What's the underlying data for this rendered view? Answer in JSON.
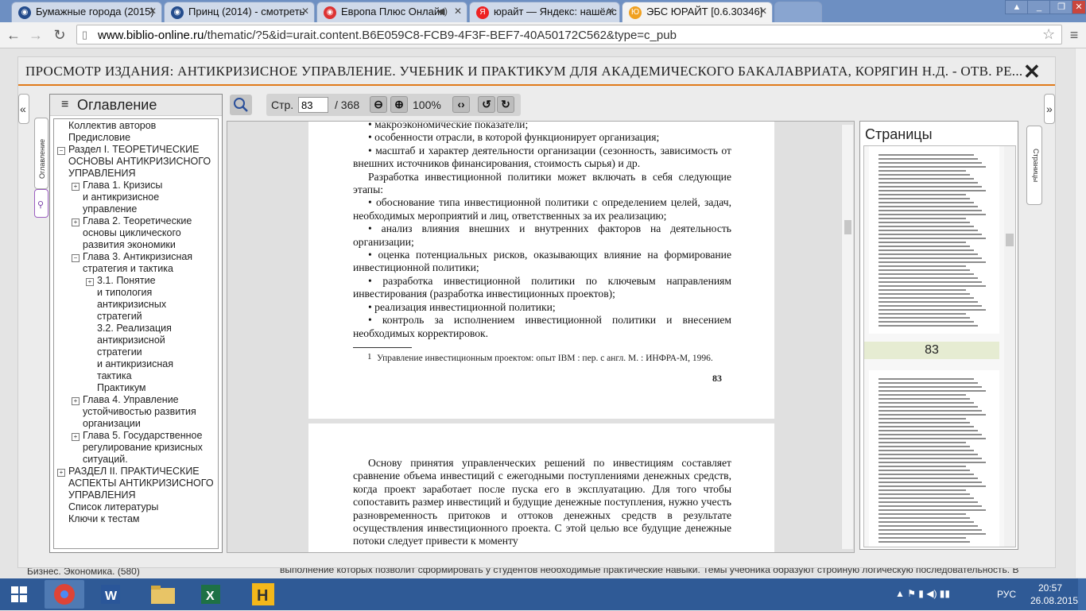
{
  "browser": {
    "tabs": [
      {
        "title": "Бумажные города (2015)",
        "active": false
      },
      {
        "title": "Принц (2014) - смотреть",
        "active": false
      },
      {
        "title": "Европа Плюс Онлайн",
        "active": false
      },
      {
        "title": "юрайт — Яндекс: нашёлс",
        "active": false
      },
      {
        "title": "ЭБС ЮРАЙТ [0.6.30346]",
        "active": true
      }
    ],
    "url_host": "www.biblio-online.ru",
    "url_path": "/thematic/?5&id=urait.content.B6E059C8-FCB9-4F3F-BEF7-40A50172C562&type=c_pub"
  },
  "viewer": {
    "title": "ПРОСМОТР ИЗДАНИЯ: АНТИКРИЗИСНОЕ УПРАВЛЕНИЕ. УЧЕБНИК И ПРАКТИКУМ ДЛЯ АКАДЕМИЧЕСКОГО БАКАЛАВРИАТА, КОРЯГИН Н.Д. - ОТВ. РЕ...",
    "close_glyph": "✕",
    "left_tab_label": "Оглавление",
    "right_tab_label": "Страницы",
    "collapse_left": "«",
    "collapse_right": "»",
    "toc_title": "Оглавление",
    "pager": {
      "page_label": "Стр.",
      "current_page": "83",
      "total": "/ 368",
      "zoom": "100%"
    },
    "toc_items": [
      {
        "label": "Коллектив авторов",
        "toggle": ""
      },
      {
        "label": "Предисловие",
        "toggle": ""
      },
      {
        "label": "Раздел I. ТЕОРЕТИЧЕСКИЕ\nОСНОВЫ АНТИКРИЗИСНОГО\nУПРАВЛЕНИЯ",
        "toggle": "−"
      },
      {
        "label": "Глава 1. Кризисы\nи антикризисное\nуправление",
        "toggle": "+"
      },
      {
        "label": "Глава 2. Теоретические\nосновы циклического\nразвития экономики",
        "toggle": "+"
      },
      {
        "label": "Глава 3. Антикризисная\nстратегия и тактика",
        "toggle": "−"
      },
      {
        "label": "3.1. Понятие\nи типология\nантикризисных\nстратегий",
        "toggle": "+"
      },
      {
        "label": "3.2. Реализация\nантикризисной\nстратегии\nи антикризисная\nтактика\nПрактикум",
        "toggle": ""
      },
      {
        "label": "Глава 4. Управление\nустойчивостью развития\nорганизации",
        "toggle": "+"
      },
      {
        "label": "Глава 5. Государственное\nрегулирование кризисных\nситуаций.",
        "toggle": "+"
      },
      {
        "label": "РАЗДЕЛ II. ПРАКТИЧЕСКИЕ\nАСПЕКТЫ АНТИКРИЗИСНОГО\nУПРАВЛЕНИЯ",
        "toggle": "+"
      },
      {
        "label": "Список литературы",
        "toggle": ""
      },
      {
        "label": "Ключи к тестам",
        "toggle": ""
      }
    ],
    "page83": {
      "lines": [
        "•  макроэкономические показатели;",
        "•  особенности отрасли, в которой функционирует организация;",
        "•  масштаб и характер деятельности организации (сезонность, зависимость от внешних источников финансирования, стоимость сырья) и др.",
        "Разработка инвестиционной политики может включать в себя следующие этапы:",
        "•  обоснование типа инвестиционной политики с определением целей, задач, необходимых мероприятий и лиц, ответственных за их реализацию;",
        "•  анализ влияния внешних и внутренних факторов на деятельность организации;",
        "•  оценка потенциальных рисков, оказывающих влияние на формирование инвестиционной политики;",
        "•  разработка инвестиционной политики по ключевым направлениям инвестирования (разработка инвестиционных проектов);",
        "•  реализация инвестиционной политики;",
        "•  контроль за исполнением инвестиционной политики и внесением необходимых корректировок."
      ],
      "footnote_mark": "1",
      "footnote": "Управление инвестиционным проектом: опыт IBM : пер. с англ. М. : ИНФРА-М, 1996.",
      "page_number": "83"
    },
    "page84_text": "Основу принятия управленческих решений по инвестициям составляет сравнение объема инвестиций с ежегодными поступлениями денежных средств, когда проект заработает после пуска его в эксплуатацию. Для того чтобы сопоставить размер инвестиций и будущие денежные поступления, нужно учесть разновременность притоков и оттоков денежных средств в результате осуществления инвестиционного проекта. С этой целью все будущие денежные потоки следует привести к моменту",
    "thumb_label": "83"
  },
  "background": {
    "left_text": "Бизнес. Экономика. (580)",
    "right_text": "выполнение которых позволит сформировать у студентов необходимые практические навыки. Темы учебника образуют стройную логическую последовательность. В"
  },
  "taskbar": {
    "lang": "РУС",
    "time": "20:57",
    "date": "26.08.2015"
  },
  "colors": {
    "accent": "#e07a1a",
    "taskbar": "#2f5a96"
  }
}
